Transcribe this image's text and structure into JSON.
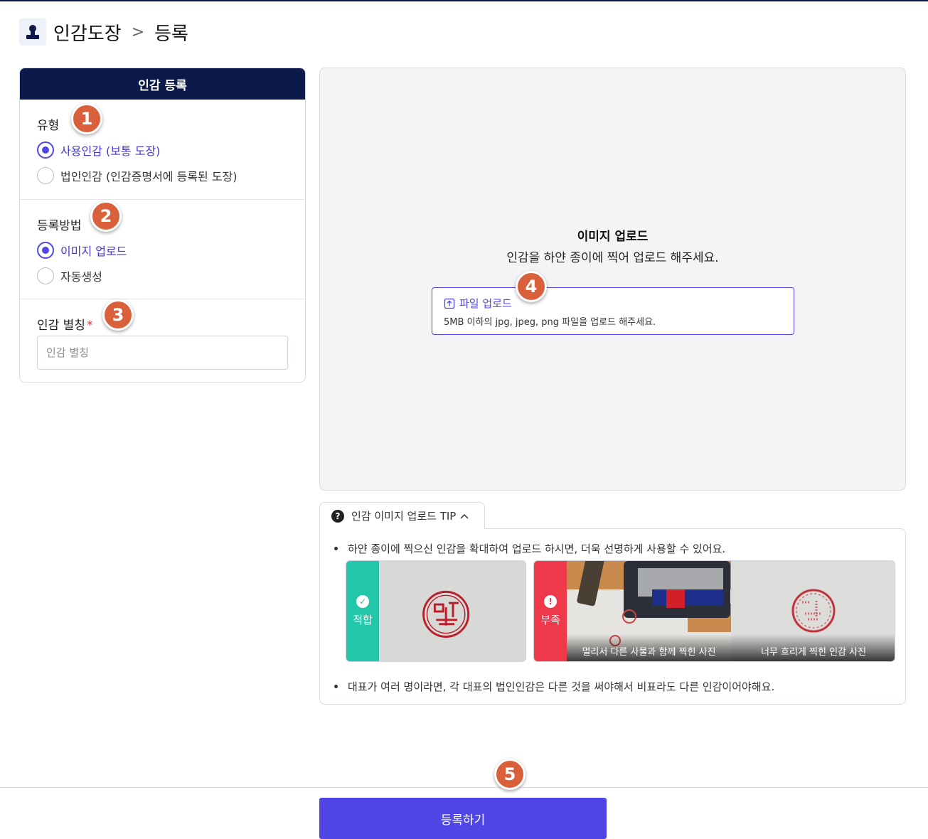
{
  "header": {
    "title": "인감도장",
    "separator": ">",
    "subtitle": "등록",
    "icon": "person-icon"
  },
  "form": {
    "card_title": "인감 등록",
    "type_section": {
      "title": "유형",
      "options": [
        {
          "label": "사용인감 (보통 도장)",
          "checked": true
        },
        {
          "label": "법인인감 (인감증명서에 등록된 도장)",
          "checked": false
        }
      ]
    },
    "method_section": {
      "title": "등록방법",
      "options": [
        {
          "label": "이미지 업로드",
          "checked": true
        },
        {
          "label": "자동생성",
          "checked": false
        }
      ]
    },
    "alias_section": {
      "title": "인감 별칭",
      "required_mark": "*",
      "placeholder": "인감 별칭",
      "value": ""
    }
  },
  "upload": {
    "title": "이미지 업로드",
    "description": "인감을 하얀 종이에 찍어 업로드 해주세요.",
    "button_label": "파일 업로드",
    "hint": "5MB 이하의 jpg, jpeg, png 파일을 업로드 해주세요."
  },
  "tip": {
    "tab_label": "인감 이미지 업로드 TIP",
    "line1": "하얀 종이에 찍으신 인감을 확대하여 업로드 하시면, 더욱 선명하게 사용할 수 있어요.",
    "good_label": "적합",
    "bad_label": "부족",
    "bad_caption_1": "멀리서 다른 사물과 함께 찍힌 사진",
    "bad_caption_2": "너무 흐리게 찍힌 인감 사진",
    "line2": "대표가 여러 명이라면, 각 대표의 법인인감은 다른 것을 써야해서 비표라도 다른 인감이어야해요."
  },
  "steps": [
    "1",
    "2",
    "3",
    "4",
    "5"
  ],
  "submit_label": "등록하기",
  "colors": {
    "accent": "#4f46e5",
    "navy": "#0b1a4a",
    "badge": "#d9603b",
    "good": "#22c7aa",
    "bad": "#f0384b"
  }
}
